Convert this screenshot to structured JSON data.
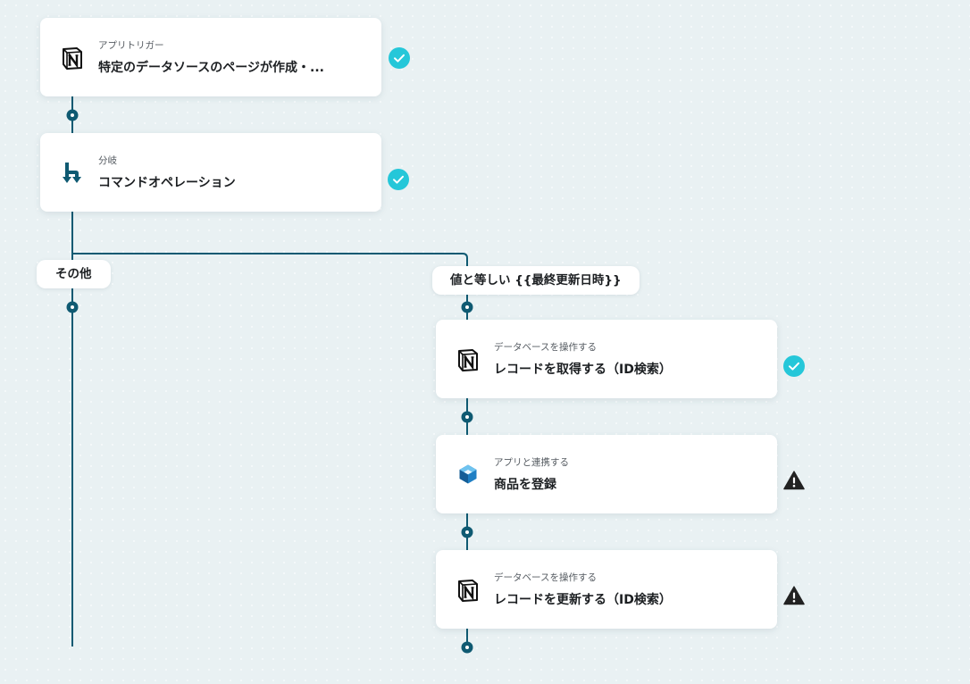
{
  "steps": {
    "trigger": {
      "subtitle": "アプリトリガー",
      "title": "特定のデータソースのページが作成・...",
      "icon": "notion-icon",
      "status": "success"
    },
    "branch": {
      "subtitle": "分岐",
      "title": "コマンドオペレーション",
      "icon": "branch-icon",
      "status": "success"
    },
    "get_record": {
      "subtitle": "データベースを操作する",
      "title": "レコードを取得する（ID検索）",
      "icon": "notion-icon",
      "status": "success"
    },
    "register_product": {
      "subtitle": "アプリと連携する",
      "title": "商品を登録",
      "icon": "cube-app-icon",
      "status": "warning"
    },
    "update_record": {
      "subtitle": "データベースを操作する",
      "title": "レコードを更新する（ID検索）",
      "icon": "notion-icon",
      "status": "warning"
    }
  },
  "branches": {
    "other_label": "その他",
    "condition_label": "値と等しい {{最終更新日時}}"
  },
  "colors": {
    "line": "#0f5a72",
    "success": "#25c7d9",
    "warning": "#222222",
    "branch_icon": "#0f5a72",
    "cube_blue": "#1f7fc4"
  }
}
